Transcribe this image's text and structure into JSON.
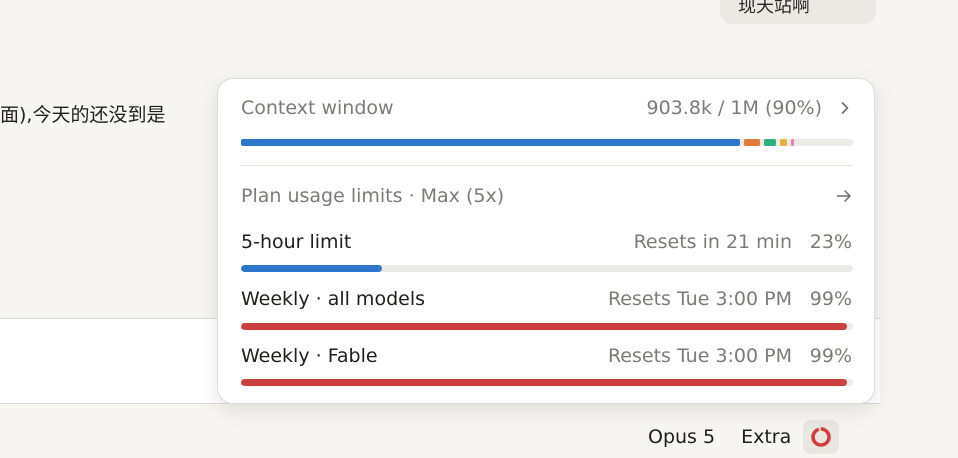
{
  "background": {
    "bubble_text": "现天站啊",
    "chat_line": "面),今天的还没到是"
  },
  "bottom_bar": {
    "model": "Opus 5",
    "extra": "Extra",
    "usage_icon": "usage-ring-icon"
  },
  "popover": {
    "context": {
      "label": "Context window",
      "value": "903.8k / 1M (90%)",
      "icon": "chevron-right-icon",
      "segments": [
        {
          "name": "main",
          "fraction": 0.815,
          "color": "#2e75cc"
        },
        {
          "name": "s2",
          "fraction": 0.026,
          "color": "#e07b39"
        },
        {
          "name": "s3",
          "fraction": 0.02,
          "color": "#2fae7e"
        },
        {
          "name": "s4",
          "fraction": 0.011,
          "color": "#e3b13b"
        },
        {
          "name": "s5",
          "fraction": 0.004,
          "color": "#e77fae"
        }
      ]
    },
    "plan": {
      "label": "Plan usage limits · Max (5x)",
      "icon": "arrow-right-icon"
    },
    "limits": [
      {
        "name": "5-hour limit",
        "reset": "Resets in 21 min",
        "percent": "23%",
        "fraction": 0.23,
        "color": "#2e75cc"
      },
      {
        "name": "Weekly · all models",
        "reset": "Resets Tue 3:00 PM",
        "percent": "99%",
        "fraction": 0.99,
        "color": "#cc3f3f"
      },
      {
        "name": "Weekly · Fable",
        "reset": "Resets Tue 3:00 PM",
        "percent": "99%",
        "fraction": 0.99,
        "color": "#cc3f3f"
      }
    ]
  }
}
